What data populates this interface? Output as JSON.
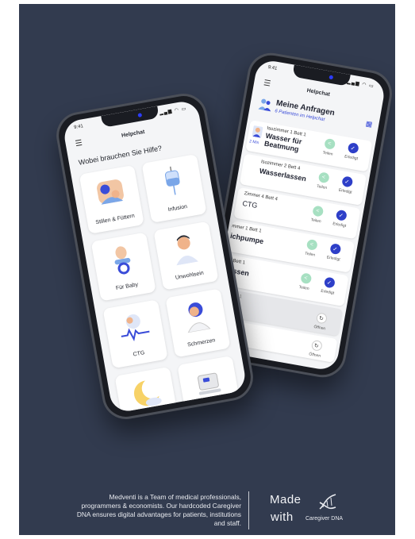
{
  "colors": {
    "background": "#323b4f",
    "accent_blue": "#2e3fc8",
    "share_green": "#a7e0c2"
  },
  "left_phone": {
    "time": "9:41",
    "header_title": "Helpchat",
    "question": "Wobei brauchen Sie Hilfe?",
    "tiles": [
      {
        "label": "Stillen & Füttern",
        "icon": "mother-baby-icon"
      },
      {
        "label": "Infusion",
        "icon": "infusion-bag-icon"
      },
      {
        "label": "Für Baby",
        "icon": "pacifier-icon"
      },
      {
        "label": "Unwohlsein",
        "icon": "unwell-person-icon"
      },
      {
        "label": "CTG",
        "icon": "ctg-monitor-icon"
      },
      {
        "label": "Schmerzen",
        "icon": "pain-person-icon"
      },
      {
        "label": "",
        "icon": "moon-night-icon"
      },
      {
        "label": "",
        "icon": "device-icon"
      }
    ]
  },
  "right_phone": {
    "time": "9:41",
    "header_title": "Helpchat",
    "requests_title": "Meine Anfragen",
    "requests_subtitle": "6 Patienten im Helpchat",
    "actions": {
      "share": "Teilen",
      "done": "Erledigt",
      "open": "Öffnen"
    },
    "requests": [
      {
        "room": "Isozimmer 1  Bett 1",
        "task": "Wasser für Beatmung",
        "time_ago": "2 Min"
      },
      {
        "room": "Isozimmer 2  Bett 4",
        "task": "Wasserlassen"
      },
      {
        "room": "Zimmer 4    Bett 4",
        "task": "CTG"
      },
      {
        "room": "mmer 1 Bett 1",
        "task": "ichpumpe"
      },
      {
        "room": "r 5 Bett 1",
        "task": "rlassen"
      },
      {
        "room": "er 2 Bett 1"
      }
    ]
  },
  "footer": {
    "tagline": "Medventi is a Team of medical professionals, programmers & economists. Our hardcoded Caregiver DNA ensures digital advantages for patients, institutions and staff.",
    "made": "Made",
    "with": "with",
    "brand": "Caregiver DNA"
  }
}
